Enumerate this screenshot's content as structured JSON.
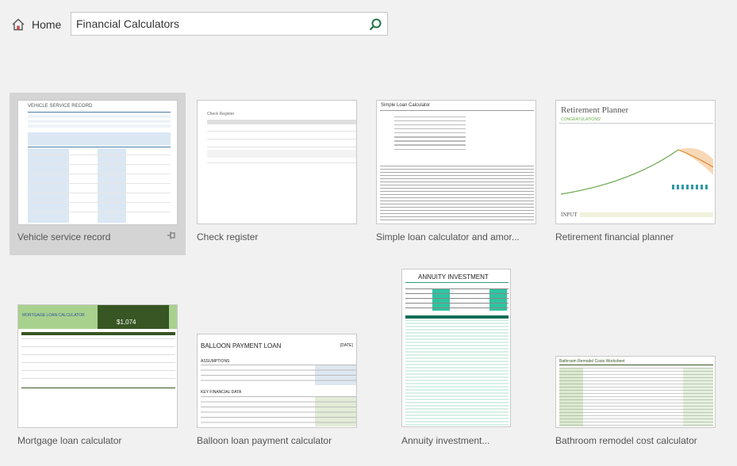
{
  "header": {
    "home_label": "Home",
    "search_value": "Financial Calculators"
  },
  "icons": {
    "home": "home-icon",
    "search": "search-icon",
    "pin": "pin-icon"
  },
  "colors": {
    "accent_green": "#217346",
    "selected_bg": "#d4d4d4",
    "page_bg": "#f1f1f1"
  },
  "templates": [
    {
      "title": "Vehicle service record",
      "thumb_heading": "VEHICLE SERVICE RECORD"
    },
    {
      "title": "Check register",
      "thumb_heading": "Check Register"
    },
    {
      "title": "Simple loan calculator and amor...",
      "thumb_heading": "Simple Loan Calculator"
    },
    {
      "title": "Retirement financial planner",
      "thumb_heading": "Retirement Planner",
      "thumb_sub": "CONGRATULATIONS!",
      "thumb_input": "INPUT"
    },
    {
      "title": "Mortgage loan calculator",
      "thumb_heading": "MORTGAGE LOAN CALCULATOR",
      "thumb_value": "$1,074"
    },
    {
      "title": "Balloon loan payment calculator",
      "thumb_heading": "BALLOON PAYMENT LOAN",
      "thumb_date": "[DATE]",
      "thumb_sec1": "ASSUMPTIONS",
      "thumb_sec2": "KEY FINANCIAL DATA"
    },
    {
      "title": "Annuity investment...",
      "thumb_heading": "ANNUITY INVESTMENT"
    },
    {
      "title": "Bathroom remodel cost calculator",
      "thumb_heading": "Bathroom Remodel Costs Worksheet"
    }
  ]
}
